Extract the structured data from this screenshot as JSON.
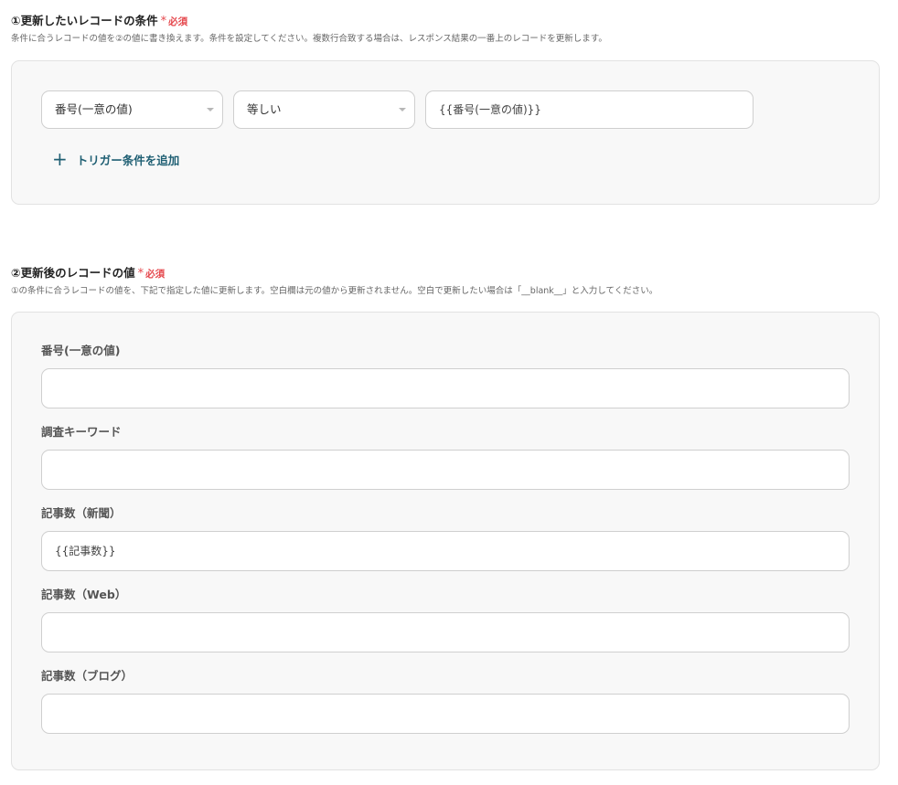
{
  "section1": {
    "title": "①更新したいレコードの条件",
    "required_star": "*",
    "required_label": "必須",
    "description": "条件に合うレコードの値を②の値に書き換えます。条件を設定してください。複数行合致する場合は、レスポンス結果の一番上のレコードを更新します。",
    "condition": {
      "field_value": "番号(一意の値)",
      "operator_value": "等しい",
      "compare_value": "{{番号(一意の値)}}"
    },
    "add_condition_icon": "plus-icon",
    "add_condition_label": "トリガー条件を追加"
  },
  "section2": {
    "title": "②更新後のレコードの値",
    "required_star": "*",
    "required_label": "必須",
    "description": "①の条件に合うレコードの値を、下記で指定した値に更新します。空白欄は元の値から更新されません。空白で更新したい場合は「__blank__」と入力してください。",
    "fields": [
      {
        "label": "番号(一意の値)",
        "value": ""
      },
      {
        "label": "調査キーワード",
        "value": ""
      },
      {
        "label": "記事数（新聞）",
        "value": "{{記事数}}"
      },
      {
        "label": "記事数（Web）",
        "value": ""
      },
      {
        "label": "記事数（ブログ）",
        "value": ""
      }
    ]
  },
  "colors": {
    "required": "#e5484d",
    "link": "#1f5f73",
    "panel_bg": "#f8f8f8",
    "border": "#cfcfcf"
  }
}
